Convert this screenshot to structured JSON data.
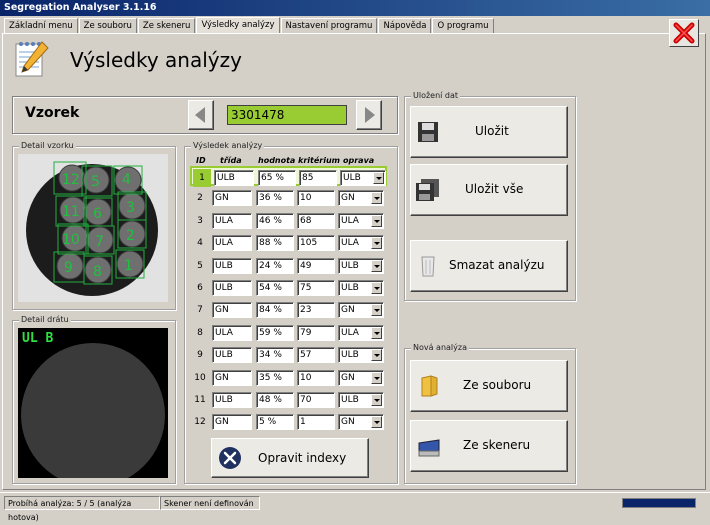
{
  "window": {
    "title": "Segregation Analyser 3.1.16"
  },
  "tabs": [
    "Základní menu",
    "Ze souboru",
    "Ze skeneru",
    "Výsledky analýzy",
    "Nastavení programu",
    "Nápověda",
    "O programu"
  ],
  "page": {
    "title": "Výsledky analýzy",
    "icon": "notepad-pencil-icon"
  },
  "sample": {
    "label": "Vzorek",
    "id": "3301478",
    "prev_icon": "arrow-left-icon",
    "next_icon": "arrow-right-icon"
  },
  "detail_sample": {
    "label": "Detail vzorku",
    "region_numbers": [
      "12",
      "5",
      "4",
      "11",
      "6",
      "3",
      "10",
      "7",
      "2",
      "9",
      "8",
      "1"
    ]
  },
  "detail_wire": {
    "label": "Detail drátu",
    "overlay_text": "UL B"
  },
  "results": {
    "label": "Výsledek analýzy",
    "columns": [
      "ID",
      "třída",
      "hodnota",
      "kritérium",
      "oprava"
    ],
    "rows": [
      [
        "1",
        "ULB",
        "65 %",
        "85",
        "ULB"
      ],
      [
        "2",
        "GN",
        "36 %",
        "10",
        "GN"
      ],
      [
        "3",
        "ULA",
        "46 %",
        "68",
        "ULA"
      ],
      [
        "4",
        "ULA",
        "88 %",
        "105",
        "ULA"
      ],
      [
        "5",
        "ULB",
        "24 %",
        "49",
        "ULB"
      ],
      [
        "6",
        "ULB",
        "54 %",
        "75",
        "ULB"
      ],
      [
        "7",
        "GN",
        "84 %",
        "23",
        "GN"
      ],
      [
        "8",
        "ULA",
        "59 %",
        "79",
        "ULA"
      ],
      [
        "9",
        "ULB",
        "34 %",
        "57",
        "ULB"
      ],
      [
        "10",
        "GN",
        "35 %",
        "10",
        "GN"
      ],
      [
        "11",
        "ULB",
        "48 %",
        "70",
        "ULB"
      ],
      [
        "12",
        "GN",
        "5 %",
        "1",
        "GN"
      ]
    ],
    "fix_button": "Opravit indexy"
  },
  "save": {
    "label": "Uložení dat",
    "save": "Uložit",
    "save_all": "Uložit vše",
    "delete": "Smazat analýzu"
  },
  "new": {
    "label": "Nová analýza",
    "from_file": "Ze souboru",
    "from_scanner": "Ze skeneru"
  },
  "status": {
    "progress": "Probíhá analýza: 5 / 5 (analýza hotova)",
    "scanner": "Skener není definován",
    "progress_fraction": 1.0
  },
  "colors": {
    "accent_green": "#99cc33",
    "title_bar": "#0a246a",
    "close_red": "#cc0000"
  }
}
